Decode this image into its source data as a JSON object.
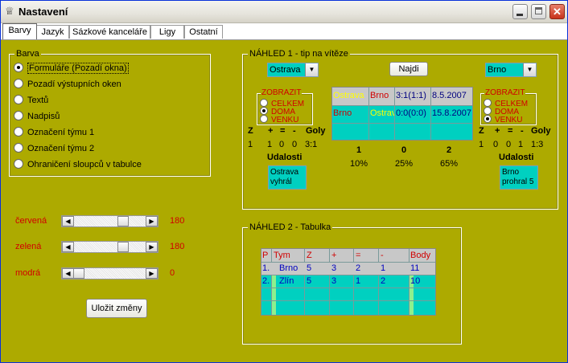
{
  "window": {
    "title": "Nastavení"
  },
  "tabs": [
    {
      "label": "Barvy",
      "active": true
    },
    {
      "label": "Jazyk",
      "active": false
    },
    {
      "label": "Sázkové kanceláře",
      "active": false
    },
    {
      "label": "Ligy",
      "active": false
    },
    {
      "label": "Ostatní",
      "active": false
    }
  ],
  "barva": {
    "label": "Barva",
    "options": [
      {
        "label": "Formuláře (Pozadí okna)",
        "selected": true
      },
      {
        "label": "Pozadí výstupních oken",
        "selected": false
      },
      {
        "label": "Textů",
        "selected": false
      },
      {
        "label": "Nadpisů",
        "selected": false
      },
      {
        "label": "Označení týmu 1",
        "selected": false
      },
      {
        "label": "Označení týmu 2",
        "selected": false
      },
      {
        "label": "Ohraničení sloupců v tabulce",
        "selected": false
      }
    ]
  },
  "sliders": [
    {
      "label": "červená",
      "value": "180"
    },
    {
      "label": "zelená",
      "value": "180"
    },
    {
      "label": "modrá",
      "value": "0"
    }
  ],
  "save_button": "Uložit změny",
  "preview1": {
    "label": "NÁHLED 1 - tip na vítěze",
    "left_team": "Ostrava",
    "right_team": "Brno",
    "find_button": "Najdi",
    "zobrazit_label": "ZOBRAZIT",
    "zobrazit_options": [
      "CELKEM",
      "DOMA",
      "VENKU"
    ],
    "left_zobrazit_selected": 1,
    "right_zobrazit_selected": 2,
    "headers": [
      "Z",
      "+",
      "=",
      "-",
      "Goly"
    ],
    "left_stats": [
      "1",
      "1",
      "0",
      "0",
      "3:1"
    ],
    "right_stats": [
      "1",
      "0",
      "0",
      "1",
      "1:3"
    ],
    "udalosti_label": "Udalosti",
    "left_event": "Ostrava vyhrál",
    "right_event": "Brno prohral 5",
    "matches": [
      {
        "home": "Ostrava",
        "away": "Brno",
        "score": "3:1(1:1)",
        "date": "8.5.2007"
      },
      {
        "home": "Brno",
        "away": "Ostrava",
        "score": "0:0(0:0)",
        "date": "15.8.2007"
      }
    ],
    "tip_labels": [
      "1",
      "0",
      "2"
    ],
    "tip_percents": [
      "10%",
      "25%",
      "65%"
    ]
  },
  "preview2": {
    "label": "NÁHLED 2 - Tabulka",
    "columns": [
      "P",
      "Tym",
      "Z",
      "+",
      "=",
      "-",
      "Body"
    ],
    "rows": [
      [
        "1.",
        "Brno",
        "5",
        "3",
        "2",
        "1",
        "11"
      ],
      [
        "2.",
        "Zlín",
        "5",
        "3",
        "1",
        "2",
        "10"
      ]
    ]
  },
  "colors": {
    "form_bg": "#adaa00",
    "teal": "#00d0c0",
    "accent_red": "#d00000",
    "highlight_gray": "#c8c8c8"
  }
}
